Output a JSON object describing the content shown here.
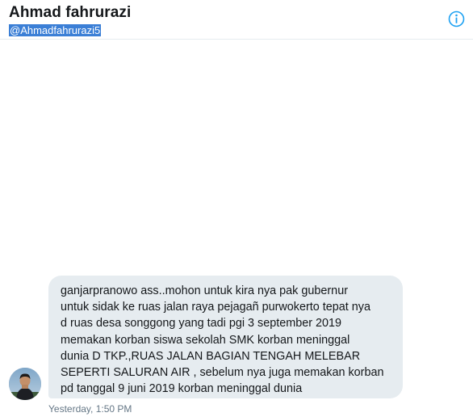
{
  "header": {
    "display_name": "Ahmad fahrurazi",
    "handle": "@Ahmadfahrurazi5",
    "info_icon": "info-circle-icon"
  },
  "message": {
    "text": "ganjarpranowo ass..mohon untuk kira nya pak gubernur\nuntuk sidak ke ruas jalan raya pejagañ purwokerto tepat nya\nd ruas desa songgong yang tadi pgi 3 september 2019\nmemakan korban siswa sekolah SMK korban meninggal\ndunia D TKP.,RUAS JALAN BAGIAN TENGAH MELEBAR\nSEPERTI SALURAN AIR , sebelum nya juga memakan korban\npd tanggal 9 juni 2019 korban meninggal dunia",
    "timestamp": "Yesterday, 1:50 PM"
  },
  "colors": {
    "accent": "#1da1f2",
    "bubble": "#e6ecf0",
    "selection": "#3b7fd6",
    "muted_text": "#657786"
  }
}
